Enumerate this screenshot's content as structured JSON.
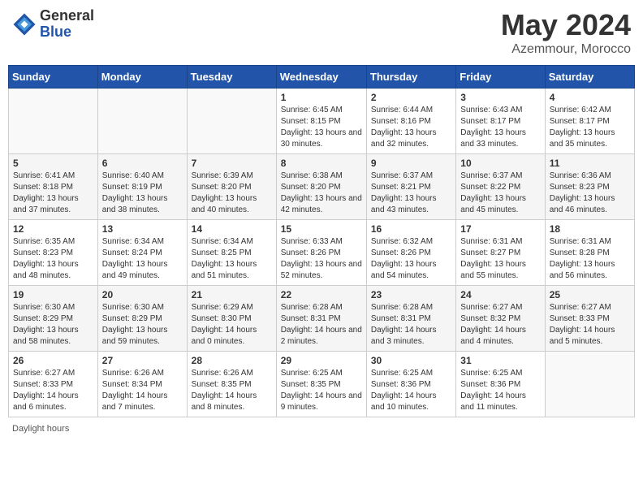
{
  "header": {
    "logo_general": "General",
    "logo_blue": "Blue",
    "month_title": "May 2024",
    "location": "Azemmour, Morocco"
  },
  "footer": {
    "daylight_label": "Daylight hours"
  },
  "days_of_week": [
    "Sunday",
    "Monday",
    "Tuesday",
    "Wednesday",
    "Thursday",
    "Friday",
    "Saturday"
  ],
  "weeks": [
    [
      {
        "num": "",
        "sunrise": "",
        "sunset": "",
        "daylight": ""
      },
      {
        "num": "",
        "sunrise": "",
        "sunset": "",
        "daylight": ""
      },
      {
        "num": "",
        "sunrise": "",
        "sunset": "",
        "daylight": ""
      },
      {
        "num": "1",
        "sunrise": "Sunrise: 6:45 AM",
        "sunset": "Sunset: 8:15 PM",
        "daylight": "Daylight: 13 hours and 30 minutes."
      },
      {
        "num": "2",
        "sunrise": "Sunrise: 6:44 AM",
        "sunset": "Sunset: 8:16 PM",
        "daylight": "Daylight: 13 hours and 32 minutes."
      },
      {
        "num": "3",
        "sunrise": "Sunrise: 6:43 AM",
        "sunset": "Sunset: 8:17 PM",
        "daylight": "Daylight: 13 hours and 33 minutes."
      },
      {
        "num": "4",
        "sunrise": "Sunrise: 6:42 AM",
        "sunset": "Sunset: 8:17 PM",
        "daylight": "Daylight: 13 hours and 35 minutes."
      }
    ],
    [
      {
        "num": "5",
        "sunrise": "Sunrise: 6:41 AM",
        "sunset": "Sunset: 8:18 PM",
        "daylight": "Daylight: 13 hours and 37 minutes."
      },
      {
        "num": "6",
        "sunrise": "Sunrise: 6:40 AM",
        "sunset": "Sunset: 8:19 PM",
        "daylight": "Daylight: 13 hours and 38 minutes."
      },
      {
        "num": "7",
        "sunrise": "Sunrise: 6:39 AM",
        "sunset": "Sunset: 8:20 PM",
        "daylight": "Daylight: 13 hours and 40 minutes."
      },
      {
        "num": "8",
        "sunrise": "Sunrise: 6:38 AM",
        "sunset": "Sunset: 8:20 PM",
        "daylight": "Daylight: 13 hours and 42 minutes."
      },
      {
        "num": "9",
        "sunrise": "Sunrise: 6:37 AM",
        "sunset": "Sunset: 8:21 PM",
        "daylight": "Daylight: 13 hours and 43 minutes."
      },
      {
        "num": "10",
        "sunrise": "Sunrise: 6:37 AM",
        "sunset": "Sunset: 8:22 PM",
        "daylight": "Daylight: 13 hours and 45 minutes."
      },
      {
        "num": "11",
        "sunrise": "Sunrise: 6:36 AM",
        "sunset": "Sunset: 8:23 PM",
        "daylight": "Daylight: 13 hours and 46 minutes."
      }
    ],
    [
      {
        "num": "12",
        "sunrise": "Sunrise: 6:35 AM",
        "sunset": "Sunset: 8:23 PM",
        "daylight": "Daylight: 13 hours and 48 minutes."
      },
      {
        "num": "13",
        "sunrise": "Sunrise: 6:34 AM",
        "sunset": "Sunset: 8:24 PM",
        "daylight": "Daylight: 13 hours and 49 minutes."
      },
      {
        "num": "14",
        "sunrise": "Sunrise: 6:34 AM",
        "sunset": "Sunset: 8:25 PM",
        "daylight": "Daylight: 13 hours and 51 minutes."
      },
      {
        "num": "15",
        "sunrise": "Sunrise: 6:33 AM",
        "sunset": "Sunset: 8:26 PM",
        "daylight": "Daylight: 13 hours and 52 minutes."
      },
      {
        "num": "16",
        "sunrise": "Sunrise: 6:32 AM",
        "sunset": "Sunset: 8:26 PM",
        "daylight": "Daylight: 13 hours and 54 minutes."
      },
      {
        "num": "17",
        "sunrise": "Sunrise: 6:31 AM",
        "sunset": "Sunset: 8:27 PM",
        "daylight": "Daylight: 13 hours and 55 minutes."
      },
      {
        "num": "18",
        "sunrise": "Sunrise: 6:31 AM",
        "sunset": "Sunset: 8:28 PM",
        "daylight": "Daylight: 13 hours and 56 minutes."
      }
    ],
    [
      {
        "num": "19",
        "sunrise": "Sunrise: 6:30 AM",
        "sunset": "Sunset: 8:29 PM",
        "daylight": "Daylight: 13 hours and 58 minutes."
      },
      {
        "num": "20",
        "sunrise": "Sunrise: 6:30 AM",
        "sunset": "Sunset: 8:29 PM",
        "daylight": "Daylight: 13 hours and 59 minutes."
      },
      {
        "num": "21",
        "sunrise": "Sunrise: 6:29 AM",
        "sunset": "Sunset: 8:30 PM",
        "daylight": "Daylight: 14 hours and 0 minutes."
      },
      {
        "num": "22",
        "sunrise": "Sunrise: 6:28 AM",
        "sunset": "Sunset: 8:31 PM",
        "daylight": "Daylight: 14 hours and 2 minutes."
      },
      {
        "num": "23",
        "sunrise": "Sunrise: 6:28 AM",
        "sunset": "Sunset: 8:31 PM",
        "daylight": "Daylight: 14 hours and 3 minutes."
      },
      {
        "num": "24",
        "sunrise": "Sunrise: 6:27 AM",
        "sunset": "Sunset: 8:32 PM",
        "daylight": "Daylight: 14 hours and 4 minutes."
      },
      {
        "num": "25",
        "sunrise": "Sunrise: 6:27 AM",
        "sunset": "Sunset: 8:33 PM",
        "daylight": "Daylight: 14 hours and 5 minutes."
      }
    ],
    [
      {
        "num": "26",
        "sunrise": "Sunrise: 6:27 AM",
        "sunset": "Sunset: 8:33 PM",
        "daylight": "Daylight: 14 hours and 6 minutes."
      },
      {
        "num": "27",
        "sunrise": "Sunrise: 6:26 AM",
        "sunset": "Sunset: 8:34 PM",
        "daylight": "Daylight: 14 hours and 7 minutes."
      },
      {
        "num": "28",
        "sunrise": "Sunrise: 6:26 AM",
        "sunset": "Sunset: 8:35 PM",
        "daylight": "Daylight: 14 hours and 8 minutes."
      },
      {
        "num": "29",
        "sunrise": "Sunrise: 6:25 AM",
        "sunset": "Sunset: 8:35 PM",
        "daylight": "Daylight: 14 hours and 9 minutes."
      },
      {
        "num": "30",
        "sunrise": "Sunrise: 6:25 AM",
        "sunset": "Sunset: 8:36 PM",
        "daylight": "Daylight: 14 hours and 10 minutes."
      },
      {
        "num": "31",
        "sunrise": "Sunrise: 6:25 AM",
        "sunset": "Sunset: 8:36 PM",
        "daylight": "Daylight: 14 hours and 11 minutes."
      },
      {
        "num": "",
        "sunrise": "",
        "sunset": "",
        "daylight": ""
      }
    ]
  ]
}
